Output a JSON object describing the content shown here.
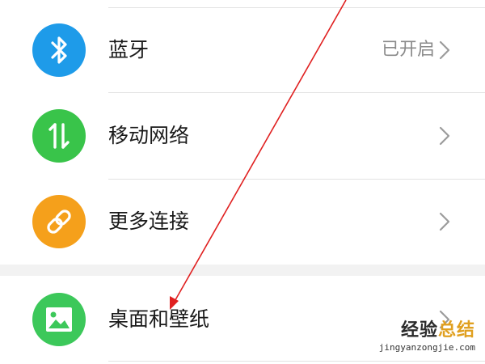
{
  "settings": {
    "items": [
      {
        "label": "蓝牙",
        "value": "已开启",
        "icon": "bluetooth-icon",
        "color": "#1e9be9"
      },
      {
        "label": "移动网络",
        "value": "",
        "icon": "mobile-data-arrows-icon",
        "color": "#39c44a"
      },
      {
        "label": "更多连接",
        "value": "",
        "icon": "link-icon",
        "color": "#f5a01b"
      },
      {
        "label": "桌面和壁纸",
        "value": "",
        "icon": "image-icon",
        "color": "#3cc85a"
      }
    ]
  },
  "annotation": {
    "arrow_color": "#e02020"
  },
  "watermark": {
    "title_main": "经验",
    "title_accent": "总结",
    "url": "jingyanzongjie.com"
  }
}
